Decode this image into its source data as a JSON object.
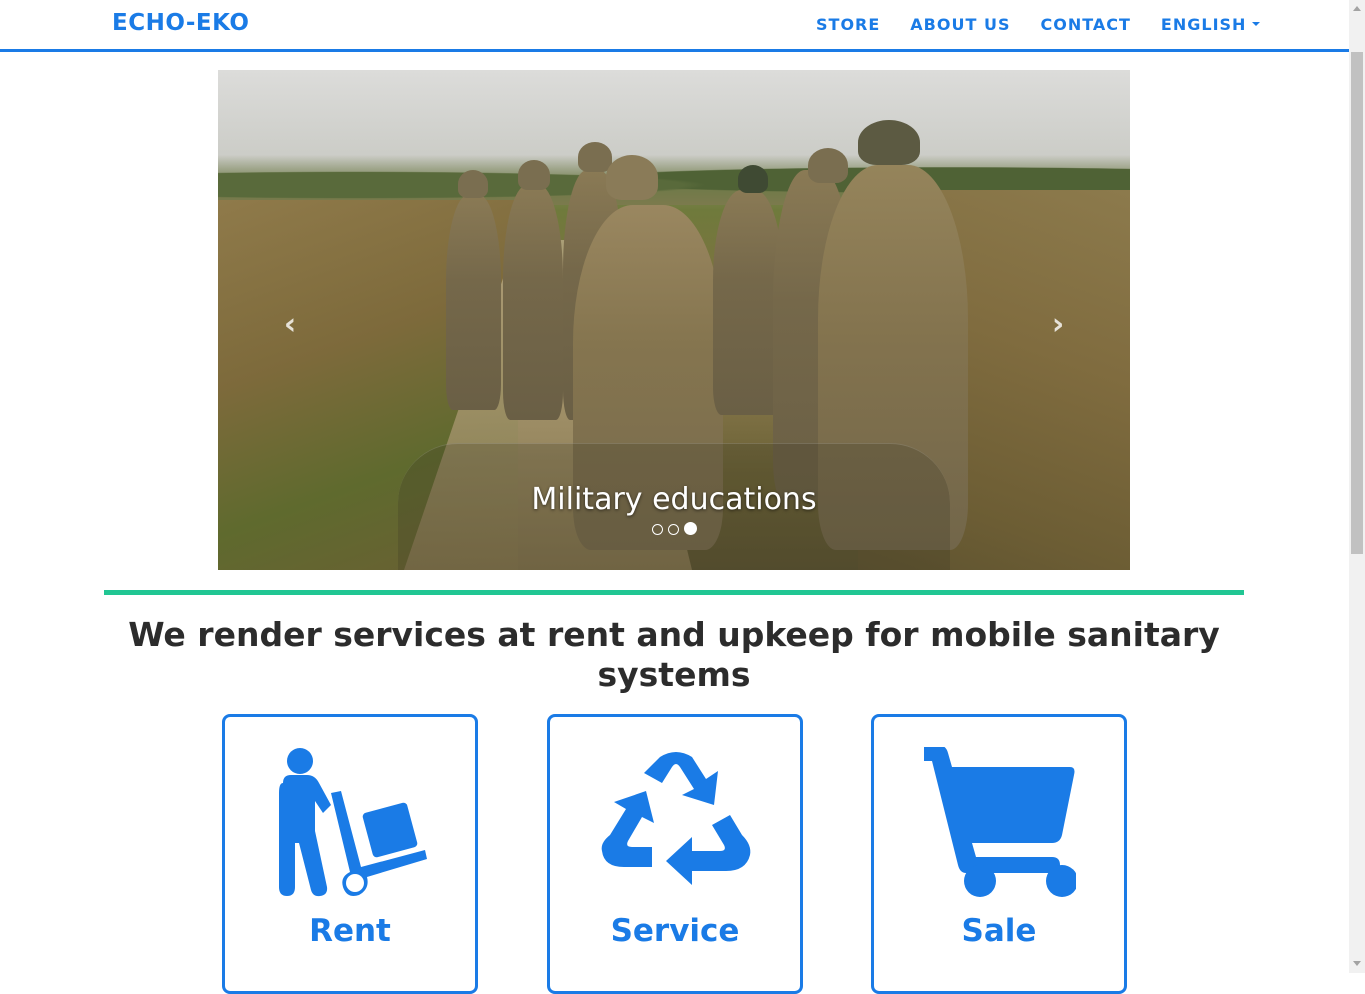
{
  "navbar": {
    "brand": "ECHO-EKO",
    "links": [
      {
        "label": "STORE"
      },
      {
        "label": "ABOUT US"
      },
      {
        "label": "CONTACT"
      },
      {
        "label": "ENGLISH"
      }
    ]
  },
  "carousel": {
    "caption": "Military educations",
    "prev_icon": "chevron-left-icon",
    "next_icon": "chevron-right-icon",
    "slide_count": 3,
    "active_slide": 3
  },
  "main": {
    "headline": "We render services at rent and upkeep for mobile sanitary systems",
    "cards": [
      {
        "title": "Rent",
        "icon": "person-dolly-icon"
      },
      {
        "title": "Service",
        "icon": "recycle-icon"
      },
      {
        "title": "Sale",
        "icon": "shopping-cart-icon"
      }
    ]
  },
  "colors": {
    "accent": "#1a7be6",
    "divider": "#21c693",
    "headline": "#2c2c2c"
  }
}
